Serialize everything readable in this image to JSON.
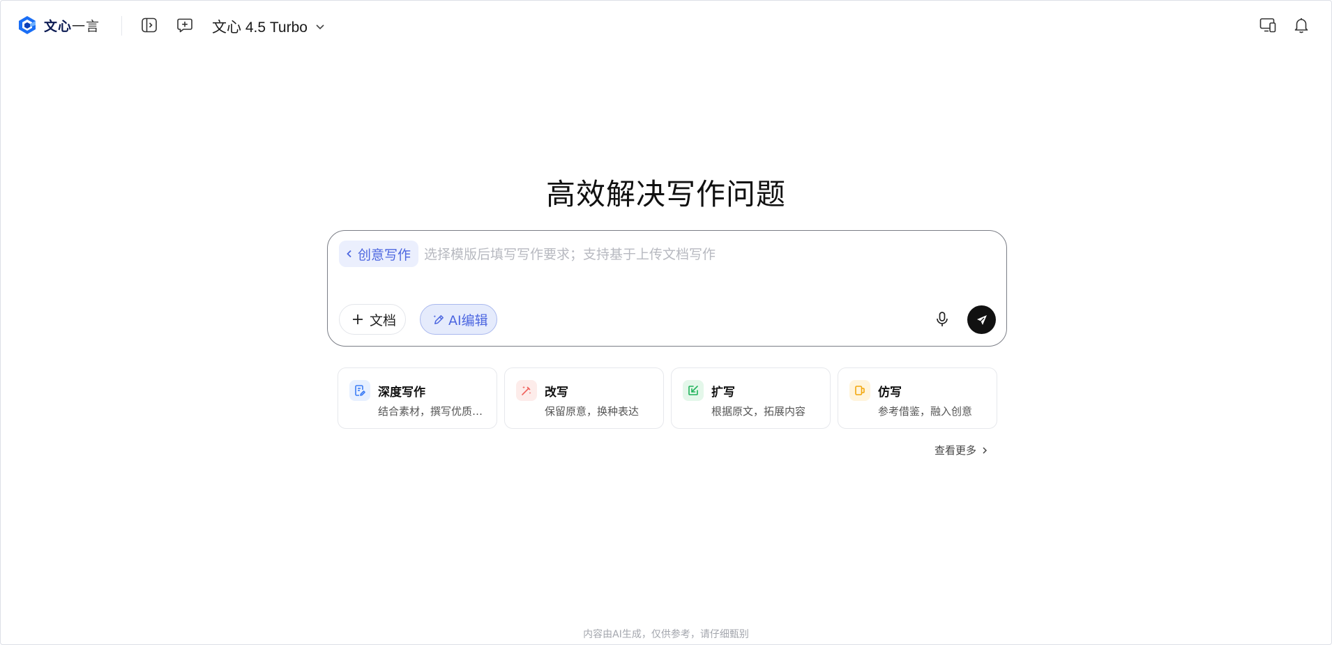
{
  "app": {
    "logo_name_bold": "文心",
    "logo_name_light": "一言",
    "model_label": "文心 4.5 Turbo"
  },
  "header": {
    "icons": [
      "sidebar-toggle-icon",
      "new-chat-icon",
      "devices-icon",
      "bell-icon"
    ]
  },
  "main": {
    "title": "高效解决写作问题",
    "composer": {
      "mode_chip": "创意写作",
      "placeholder": "选择模版后填写写作要求；支持基于上传文档写作",
      "value": "",
      "doc_button": "文档",
      "ai_edit_button": "AI编辑"
    },
    "cards": [
      {
        "title": "深度写作",
        "desc": "结合素材，撰写优质…",
        "icon": "document-pen-icon",
        "color": "#3b7cf5",
        "bg": "#e7f0ff"
      },
      {
        "title": "改写",
        "desc": "保留原意，换种表达",
        "icon": "magic-wand-icon",
        "color": "#f0605b",
        "bg": "#fdecea"
      },
      {
        "title": "扩写",
        "desc": "根据原文，拓展内容",
        "icon": "expand-arrow-icon",
        "color": "#1fb25a",
        "bg": "#e4f7ea"
      },
      {
        "title": "仿写",
        "desc": "参考借鉴，融入创意",
        "icon": "copy-cup-icon",
        "color": "#f2a60c",
        "bg": "#fff4dc"
      }
    ],
    "more_label": "查看更多"
  },
  "footer": {
    "disclaimer": "内容由AI生成，仅供参考，请仔细甄别"
  },
  "colors": {
    "accent": "#4c66e0",
    "chip_bg": "#ebeffd",
    "send_bg": "#111111"
  }
}
